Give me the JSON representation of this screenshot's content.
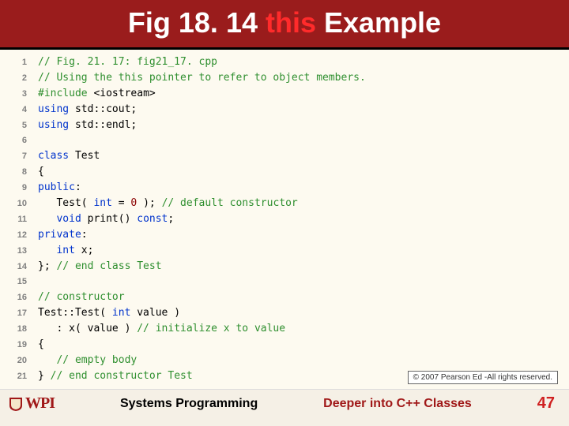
{
  "header": {
    "prefix": "Fig 18. 14 ",
    "keyword": "this",
    "suffix": " Example"
  },
  "code": [
    [
      {
        "t": "comment",
        "v": "// Fig. 21. 17: fig21_17. cpp"
      }
    ],
    [
      {
        "t": "comment",
        "v": "// Using the this pointer to refer to object members."
      }
    ],
    [
      {
        "t": "preproc",
        "v": "#include "
      },
      {
        "t": "include-lit",
        "v": "<iostream>"
      }
    ],
    [
      {
        "t": "keyword",
        "v": "using "
      },
      {
        "t": "plain",
        "v": "std::cout;"
      }
    ],
    [
      {
        "t": "keyword",
        "v": "using "
      },
      {
        "t": "plain",
        "v": "std::endl;"
      }
    ],
    [],
    [
      {
        "t": "keyword",
        "v": "class "
      },
      {
        "t": "plain",
        "v": "Test"
      }
    ],
    [
      {
        "t": "plain",
        "v": "{"
      }
    ],
    [
      {
        "t": "keyword",
        "v": "public"
      },
      {
        "t": "plain",
        "v": ":"
      }
    ],
    [
      {
        "t": "plain",
        "v": "   Test( "
      },
      {
        "t": "keyword",
        "v": "int"
      },
      {
        "t": "plain",
        "v": " = "
      },
      {
        "t": "number",
        "v": "0"
      },
      {
        "t": "plain",
        "v": " ); "
      },
      {
        "t": "comment",
        "v": "// default constructor"
      }
    ],
    [
      {
        "t": "plain",
        "v": "   "
      },
      {
        "t": "keyword",
        "v": "void"
      },
      {
        "t": "plain",
        "v": " print() "
      },
      {
        "t": "keyword",
        "v": "const"
      },
      {
        "t": "plain",
        "v": ";"
      }
    ],
    [
      {
        "t": "keyword",
        "v": "private"
      },
      {
        "t": "plain",
        "v": ":"
      }
    ],
    [
      {
        "t": "plain",
        "v": "   "
      },
      {
        "t": "keyword",
        "v": "int"
      },
      {
        "t": "plain",
        "v": " x;"
      }
    ],
    [
      {
        "t": "plain",
        "v": "}; "
      },
      {
        "t": "comment",
        "v": "// end class Test"
      }
    ],
    [],
    [
      {
        "t": "comment",
        "v": "// constructor"
      }
    ],
    [
      {
        "t": "plain",
        "v": "Test::Test( "
      },
      {
        "t": "keyword",
        "v": "int"
      },
      {
        "t": "plain",
        "v": " value )"
      }
    ],
    [
      {
        "t": "plain",
        "v": "   : x( value ) "
      },
      {
        "t": "comment",
        "v": "// initialize x to value"
      }
    ],
    [
      {
        "t": "plain",
        "v": "{"
      }
    ],
    [
      {
        "t": "plain",
        "v": "   "
      },
      {
        "t": "comment",
        "v": "// empty body"
      }
    ],
    [
      {
        "t": "plain",
        "v": "} "
      },
      {
        "t": "comment",
        "v": "// end constructor Test"
      }
    ]
  ],
  "copyright": "© 2007 Pearson Ed -All rights reserved.",
  "footer": {
    "logo_text": "WPI",
    "mid": "Systems Programming",
    "right": "Deeper into C++ Classes",
    "page": "47"
  }
}
